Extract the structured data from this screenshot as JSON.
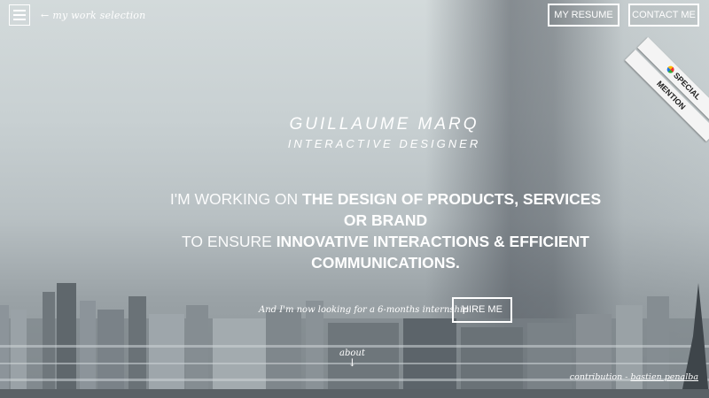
{
  "header": {
    "menu_icon": "hamburger-menu-icon",
    "work_link_arrow": "←",
    "work_link_label": "my work selection",
    "resume_label": "MY RESUME",
    "contact_label": "CONTACT ME"
  },
  "ribbon": {
    "line1": "SPECIAL",
    "line2": "MENTION"
  },
  "hero": {
    "name": "GUILLAUME MARQ",
    "role": "INTERACTIVE DESIGNER",
    "statement_p1": "I'M WORKING ON ",
    "statement_b1": "THE DESIGN OF PRODUCTS, SERVICES OR BRAND",
    "statement_p2": "TO ENSURE ",
    "statement_b2": "INNOVATIVE INTERACTIONS & EFFICIENT COMMUNICATIONS."
  },
  "cta": {
    "internship_text": "And I'm now looking for a 6-months internship",
    "hire_label": "HIRE ME"
  },
  "about": {
    "label": "about",
    "arrow": "↓"
  },
  "footer": {
    "contribution_prefix": "contribution - ",
    "contribution_author": "bastien penalba"
  }
}
